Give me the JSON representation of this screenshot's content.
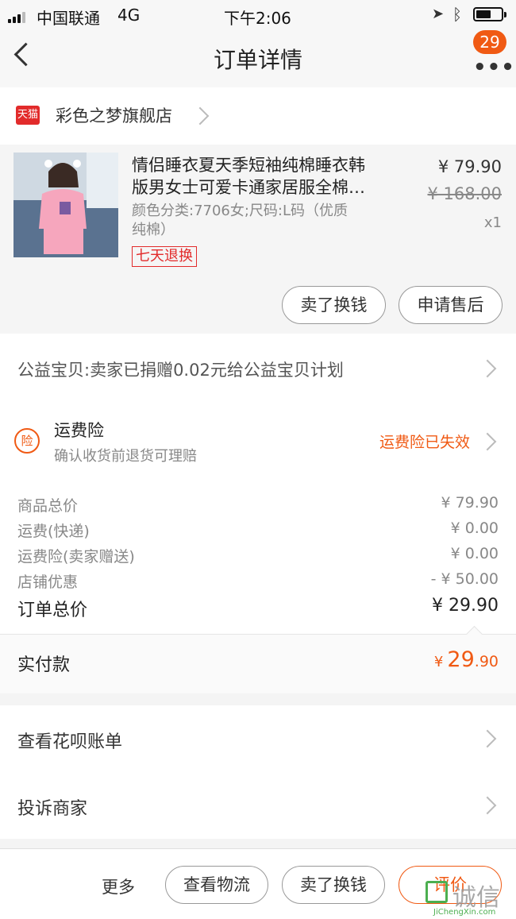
{
  "status_bar": {
    "carrier": "中国联通",
    "network": "4G",
    "time": "下午2:06"
  },
  "nav": {
    "title": "订单详情",
    "badge_count": "29"
  },
  "store": {
    "logo_text": "天猫",
    "name": "彩色之梦旗舰店"
  },
  "product": {
    "title_line1": "情侣睡衣夏天季短袖纯棉睡衣韩",
    "title_line2": "版男女士可爱卡通家居服全棉…",
    "sku_line1": "颜色分类:7706女;尺码:L码（优质",
    "sku_line2": "纯棉）",
    "tag": "七天退换",
    "price": "¥ 79.90",
    "original_price": "¥ 168.00",
    "quantity": "x1",
    "buttons": {
      "resell": "卖了换钱",
      "after_sale": "申请售后"
    }
  },
  "charity": {
    "text": "公益宝贝:卖家已捐赠0.02元给公益宝贝计划"
  },
  "insurance": {
    "icon_text": "险",
    "title": "运费险",
    "subtitle": "确认收货前退货可理赔",
    "status": "运费险已失效"
  },
  "summary": {
    "rows": [
      {
        "label": "商品总价",
        "value": "¥ 79.90"
      },
      {
        "label": "运费(快递)",
        "value": "¥ 0.00"
      },
      {
        "label": "运费险(卖家赠送)",
        "value": "¥ 0.00"
      },
      {
        "label": "店铺优惠",
        "value": "- ¥ 50.00"
      }
    ],
    "total_label": "订单总价",
    "total_value": "¥ 29.90"
  },
  "payment": {
    "label": "实付款",
    "currency": "¥",
    "amount_int": "29",
    "amount_dec": ".90"
  },
  "links": {
    "huabei": "查看花呗账单",
    "complain": "投诉商家"
  },
  "bottom_bar": {
    "more": "更多",
    "logistics": "查看物流",
    "resell": "卖了换钱",
    "review": "评价"
  },
  "watermark": {
    "text": "诚信",
    "sub": "JiChengXin.com"
  },
  "colors": {
    "accent": "#f05a14",
    "tmall_red": "#e22b2b"
  }
}
